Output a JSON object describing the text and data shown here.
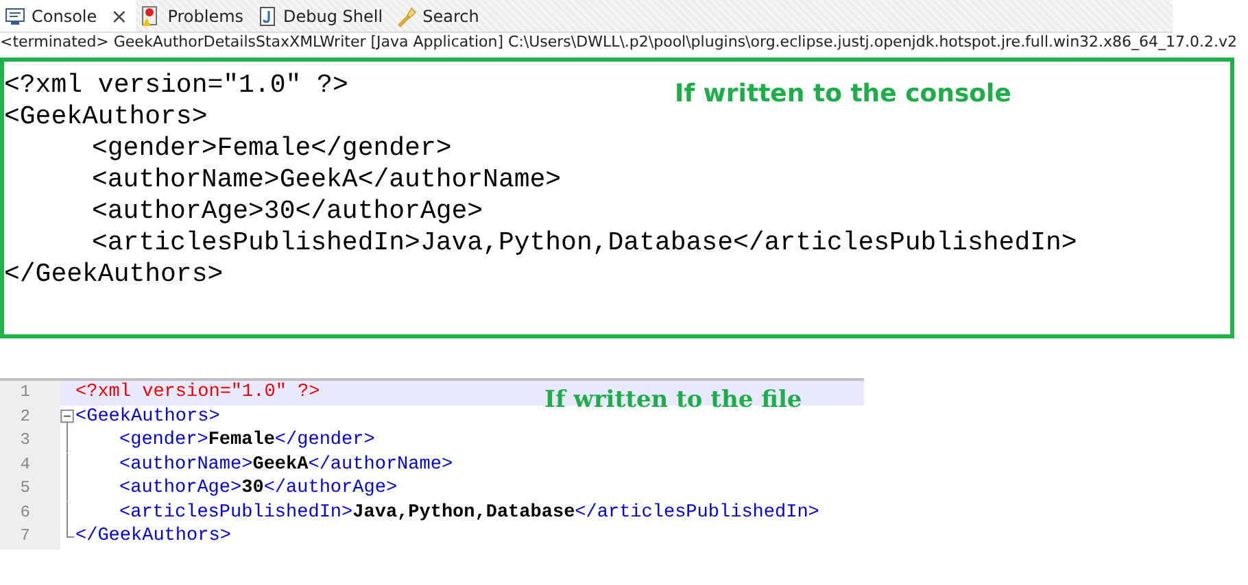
{
  "tabs": [
    {
      "label": "Console",
      "selected": true,
      "close": "×"
    },
    {
      "label": "Problems",
      "selected": false
    },
    {
      "label": "Debug Shell",
      "selected": false
    },
    {
      "label": "Search",
      "selected": false
    }
  ],
  "status_line": "<terminated> GeekAuthorDetailsStaxXMLWriter [Java Application] C:\\Users\\DWLL\\.p2\\pool\\plugins\\org.eclipse.justj.openjdk.hotspot.jre.full.win32.x86_64_17.0.2.v2",
  "console": {
    "lines": [
      {
        "text": "<?xml version=\"1.0\" ?>"
      },
      {
        "text": "<GeekAuthors>",
        "children": [
          {
            "text": "<gender>Female</gender>"
          },
          {
            "text": "<authorName>GeekA</authorName>"
          },
          {
            "text": "<authorAge>30</authorAge>"
          },
          {
            "text": "<articlesPublishedIn>Java,Python,Database</articlesPublishedIn>"
          }
        ]
      },
      {
        "text": "</GeekAuthors>"
      }
    ],
    "annotation": "If written to the console"
  },
  "editor": {
    "lines": [
      {
        "number": "1",
        "selected": true,
        "segments": [
          {
            "kind": "decl",
            "text": "<?xml version=\"1.0\" ?>"
          }
        ]
      },
      {
        "number": "2",
        "selected": false,
        "segments": [
          {
            "kind": "tag",
            "text": "<GeekAuthors>"
          }
        ],
        "children": [
          {
            "number": "3",
            "selected": false,
            "segments": [
              {
                "kind": "tag",
                "text": "<gender>"
              },
              {
                "kind": "value",
                "text": "Female"
              },
              {
                "kind": "tag",
                "text": "</gender>"
              }
            ]
          },
          {
            "number": "4",
            "selected": false,
            "segments": [
              {
                "kind": "tag",
                "text": "<authorName>"
              },
              {
                "kind": "value",
                "text": "GeekA"
              },
              {
                "kind": "tag",
                "text": "</authorName>"
              }
            ]
          },
          {
            "number": "5",
            "selected": false,
            "segments": [
              {
                "kind": "tag",
                "text": "<authorAge>"
              },
              {
                "kind": "value",
                "text": "30"
              },
              {
                "kind": "tag",
                "text": "</authorAge>"
              }
            ]
          },
          {
            "number": "6",
            "selected": false,
            "segments": [
              {
                "kind": "tag",
                "text": "<articlesPublishedIn>"
              },
              {
                "kind": "value",
                "text": "Java,Python,Database"
              },
              {
                "kind": "tag",
                "text": "</articlesPublishedIn>"
              }
            ]
          }
        ]
      },
      {
        "number": "7",
        "selected": false,
        "segments": [
          {
            "kind": "tag",
            "text": "</GeekAuthors>"
          }
        ]
      }
    ],
    "annotation": "If written to the file"
  }
}
